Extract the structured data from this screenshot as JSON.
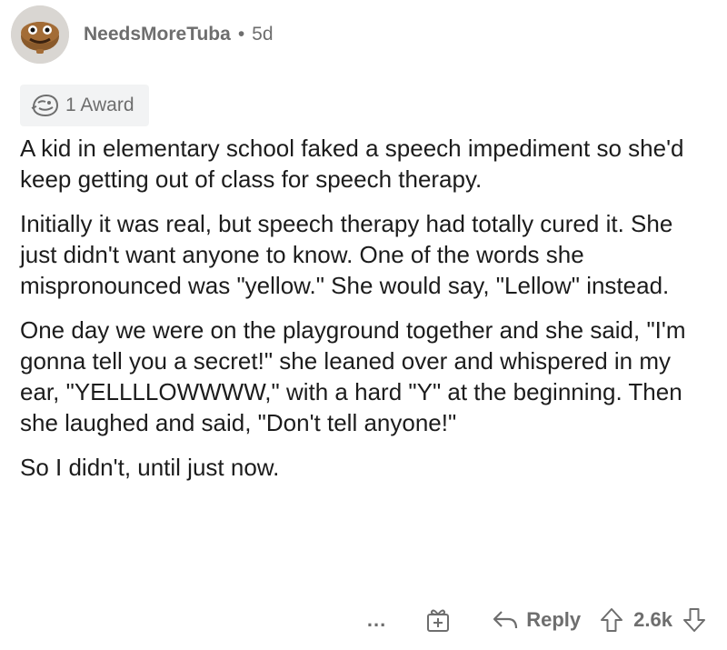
{
  "comment": {
    "author": "NeedsMoreTuba",
    "separator": "•",
    "age": "5d",
    "award_label": "1 Award",
    "paragraphs": [
      "A kid in elementary school faked a speech impediment so she'd keep getting out of class for speech therapy.",
      "Initially it was real, but speech therapy had totally cured it. She just didn't want anyone to know. One of the words she mispronounced was \"yellow.\" She would say, \"Lellow\" instead.",
      "One day we were on the playground together and she said, \"I'm gonna tell you a secret!\" she leaned over and whispered in my ear, \"YELLLLOWWWW,\" with a hard \"Y\" at the beginning. Then she laughed and said, \"Don't tell anyone!\"",
      "So I didn't, until just now."
    ]
  },
  "actions": {
    "more_label": "...",
    "reply_label": "Reply",
    "vote_count": "2.6k"
  },
  "icons": {
    "avatar": "avatar-icon",
    "award": "award-face-icon",
    "give_award": "gift-icon",
    "reply": "reply-arrow-icon",
    "upvote": "upvote-arrow-icon",
    "downvote": "downvote-arrow-icon"
  },
  "colors": {
    "text": "#1c1c1c",
    "meta": "#6e6e6e",
    "award_bg": "#f2f3f4"
  }
}
